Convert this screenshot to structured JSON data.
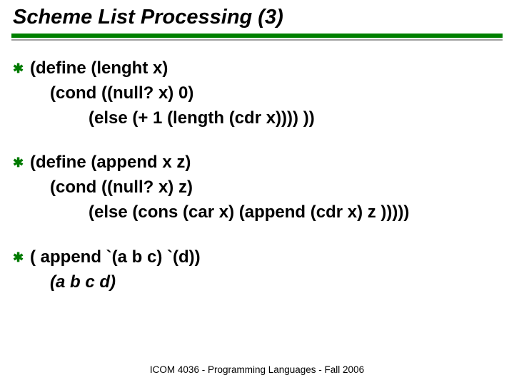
{
  "title": "Scheme List Processing (3)",
  "footer": "ICOM 4036 - Programming Languages - Fall 2006",
  "items": [
    {
      "l1": "(define (lenght x)",
      "l2": "(cond ((null? x) 0)",
      "l3": "(else (+ 1 (length (cdr x)))) ))"
    },
    {
      "l1": "(define (append x z)",
      "l2": "(cond ((null? x) z)",
      "l3": "(else (cons (car x) (append (cdr x) z )))))"
    },
    {
      "l1": "( append  `(a b c) `(d))",
      "l2": "(a b c d)"
    }
  ]
}
